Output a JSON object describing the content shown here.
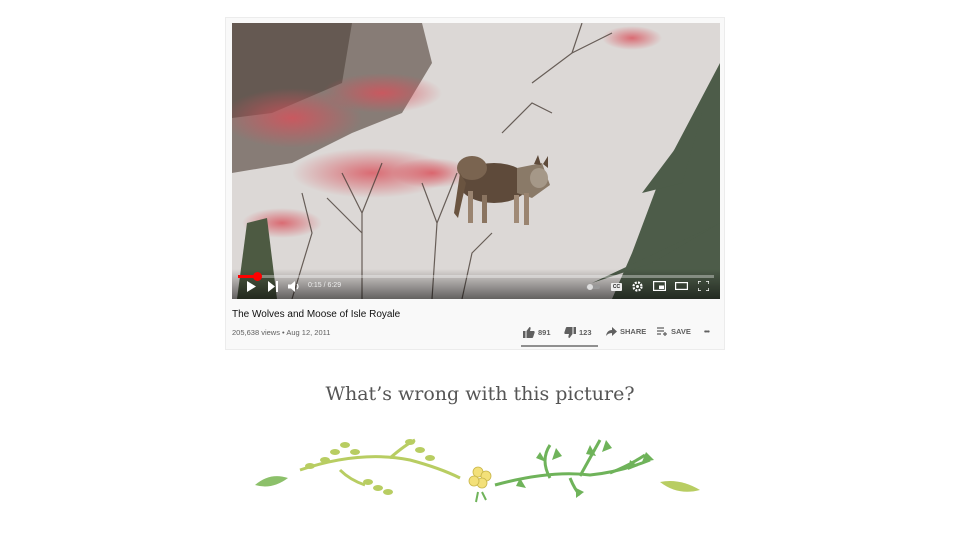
{
  "video": {
    "title": "The Wolves and Moose of Isle Royale",
    "views": "205,638 views",
    "separator": "•",
    "date": "Aug 12, 2011",
    "time_display": "0:15 / 6:29",
    "progress_fraction": 0.039,
    "cc_label": "CC"
  },
  "actions": {
    "likes": "891",
    "dislikes": "123",
    "share_label": "SHARE",
    "save_label": "SAVE",
    "more": "•••"
  },
  "caption": "What’s wrong with this picture?",
  "colors": {
    "progress": "#ff0000",
    "vine_light": "#b8cd62",
    "vine_dark": "#6fb35a",
    "flower": "#f3e079"
  }
}
